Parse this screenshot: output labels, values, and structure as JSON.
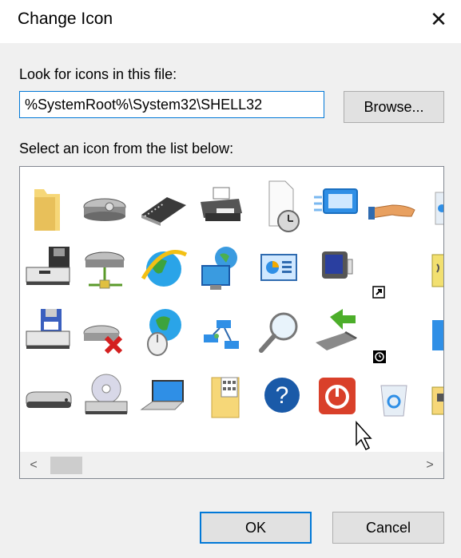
{
  "dialog": {
    "title": "Change Icon",
    "close_glyph": "✕"
  },
  "file_section": {
    "label": "Look for icons in this file:",
    "path_value": "%SystemRoot%\\System32\\SHELL32",
    "browse_label": "Browse..."
  },
  "list_section": {
    "label": "Select an icon from the list below:"
  },
  "icons": [
    "folder-icon",
    "hard-drive-icon",
    "memory-chip-icon",
    "printer-icon",
    "clock-document-icon",
    "display-window-icon",
    "sharing-hand-icon",
    "recycle-icon-partial",
    "computer-floppy-icon",
    "network-drive-icon",
    "internet-explorer-icon",
    "network-globe-icon",
    "control-panel-icon",
    "monitor-icon",
    "shortcut-arrow-icon",
    "note-icon-partial",
    "floppy-drive-icon",
    "disconnected-drive-icon",
    "globe-mouse-icon",
    "network-connection-icon",
    "magnifier-icon",
    "usb-drive-icon",
    "clock-overlay-icon",
    "blue-panel-icon-partial",
    "removable-drive-icon",
    "cd-drive-icon",
    "laptop-icon",
    "zip-folder-icon",
    "help-icon",
    "power-icon",
    "recycle-bin-icon",
    "folder-icon-partial"
  ],
  "scrollbar": {
    "left_glyph": "<",
    "right_glyph": ">"
  },
  "footer": {
    "ok_label": "OK",
    "cancel_label": "Cancel"
  },
  "colors": {
    "accent": "#0078d7",
    "power_red": "#d9402a",
    "help_blue": "#1a5aa8"
  }
}
